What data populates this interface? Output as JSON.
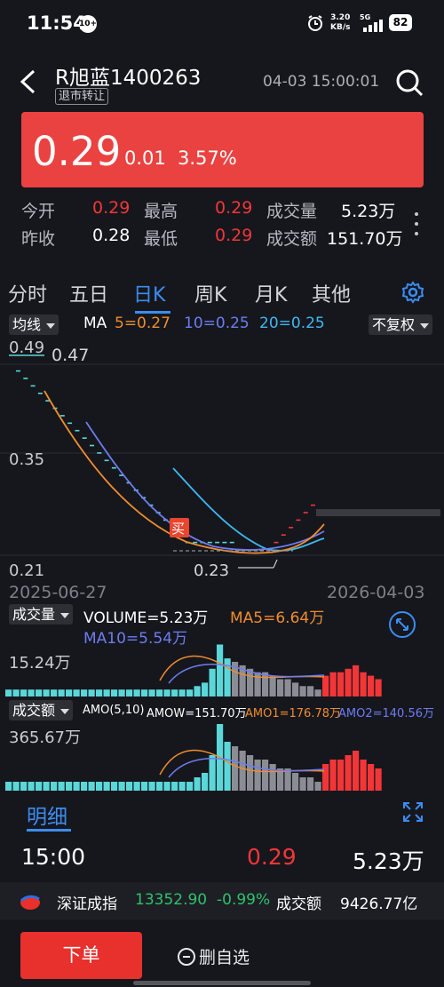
{
  "status_bar": {
    "time": "11:54",
    "notification_badge": "10+",
    "net_speed_value": "3.20",
    "net_speed_unit": "KB/s",
    "network": "5G",
    "battery": "82"
  },
  "header": {
    "title": "R旭蓝1400263",
    "tag": "退市转让",
    "datetime": "04-03 15:00:01"
  },
  "quote": {
    "price": "0.29",
    "change": "0.01",
    "change_pct": "3.57%",
    "stats": [
      {
        "label": "今开",
        "value": "0.29",
        "label2": "最高",
        "value2": "0.29",
        "label3": "成交量",
        "value3": "5.23万"
      },
      {
        "label": "昨收",
        "value": "0.28",
        "label2": "最低",
        "value2": "0.29",
        "label3": "成交额",
        "value3": "151.70万"
      }
    ]
  },
  "tabs": [
    "分时",
    "五日",
    "日K",
    "周K",
    "月K",
    "其他"
  ],
  "active_tab": "日K",
  "chart_controls": {
    "ma_dropdown": "均线",
    "ma_title": "MA",
    "ma5": "5=0.27",
    "ma10": "10=0.25",
    "ma20": "20=0.25",
    "adjust_dropdown": "不复权"
  },
  "kline_labels": {
    "y_top": "0.49",
    "high_mark": "0.47",
    "y_mid": "0.35",
    "y_low": "0.21",
    "low_mark": "0.23",
    "buy_marker": "买",
    "start_date": "2025-06-27",
    "end_date": "2026-04-03"
  },
  "volume_panel": {
    "dropdown": "成交量",
    "volume": "VOLUME=5.23万",
    "ma5": "MA5=6.64万",
    "ma10": "MA10=5.54万",
    "max": "15.24万"
  },
  "amount_panel": {
    "dropdown": "成交额",
    "amo": "AMO(5,10)",
    "amow": "AMOW=151.70万",
    "amo1": "AMO1=176.78万",
    "amo2": "AMO2=140.56万",
    "max": "365.67万"
  },
  "detail": {
    "tab": "明细",
    "time": "15:00",
    "price": "0.29",
    "volume": "5.23万"
  },
  "index_ticker": {
    "name": "深证成指",
    "value": "13352.90",
    "change": "-0.99%",
    "amount_label": "成交额",
    "amount": "9426.77亿"
  },
  "bottom": {
    "order_button": "下单",
    "remove_button": "删自选"
  },
  "chart_data": {
    "type": "candlestick",
    "x_range": [
      "2025-06-27",
      "2026-04-03"
    ],
    "ylim": [
      0.21,
      0.49
    ],
    "close_prices": [
      0.47,
      0.46,
      0.45,
      0.44,
      0.43,
      0.42,
      0.41,
      0.4,
      0.39,
      0.38,
      0.37,
      0.36,
      0.35,
      0.34,
      0.33,
      0.32,
      0.31,
      0.3,
      0.29,
      0.28,
      0.27,
      0.26,
      0.25,
      0.24,
      0.24,
      0.24,
      0.24,
      0.24,
      0.24,
      0.24,
      0.23,
      0.23,
      0.23,
      0.23,
      0.23,
      0.24,
      0.25,
      0.26,
      0.27,
      0.28,
      0.29
    ],
    "volume_up": [
      2,
      2,
      2,
      2,
      2,
      2,
      2,
      2,
      2,
      2,
      2,
      2,
      2,
      2,
      2,
      2,
      2,
      2,
      2,
      2,
      2,
      2,
      2,
      2,
      2,
      3,
      4,
      8,
      15,
      11
    ],
    "volume_down": [
      10,
      9,
      8,
      7,
      7,
      6,
      5,
      5,
      4,
      3,
      3,
      2
    ],
    "volume_recent_up": [
      6,
      7,
      7,
      8,
      9,
      7,
      6,
      5
    ],
    "colors": {
      "up": "#f23638",
      "flat_limit": "#5bd7da",
      "down": "#8b8d94",
      "ma5": "#f08c2e",
      "ma10": "#6e7cf0",
      "ma20": "#3fb8f0"
    }
  }
}
